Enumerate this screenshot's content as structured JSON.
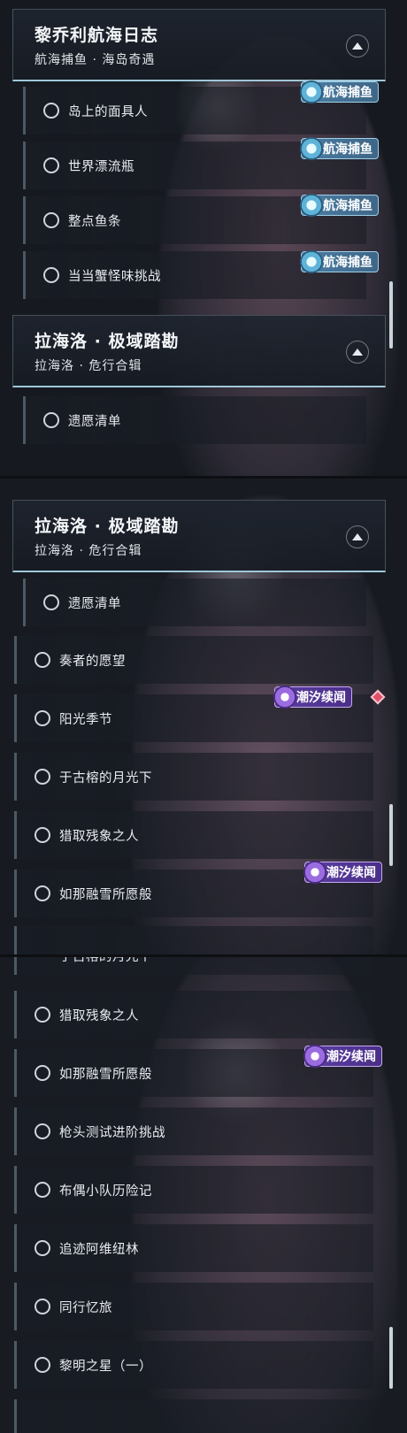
{
  "sections": [
    {
      "title": "黎乔利航海日志",
      "subtitle": "航海捕鱼 · 海岛奇遇"
    },
    {
      "title": "拉海洛 · 极域踏勘",
      "subtitle": "拉海洛 · 危行合辑"
    }
  ],
  "badges": {
    "fishing": "航海捕鱼",
    "tide": "潮汐续闻"
  },
  "icons": {
    "collapse": "chevron-up-icon",
    "fishing_badge": "fishing-badge-icon",
    "tide_badge": "tide-badge-icon",
    "alert": "red-diamond-icon"
  },
  "colors": {
    "accent_line": "#9fc7d8",
    "fishing_badge": "#3e6687",
    "tide_badge": "#4a2f88",
    "alert": "#e0506a"
  },
  "seg1": {
    "header_title": "黎乔利航海日志",
    "header_sub": "航海捕鱼 · 海岛奇遇",
    "items": [
      "岛上的面具人",
      "世界漂流瓶",
      "整点鱼条",
      "当当蟹怪味挑战"
    ],
    "header2_title": "拉海洛 · 极域踏勘",
    "header2_sub": "拉海洛 · 危行合辑",
    "item_after": "遗愿清单"
  },
  "seg2": {
    "header_title": "拉海洛 · 极域踏勘",
    "header_sub": "拉海洛 · 危行合辑",
    "items": [
      "遗愿清单",
      "奏者的愿望",
      "阳光季节",
      "于古榕的月光下",
      "猎取残象之人",
      "如那融雪所愿般"
    ]
  },
  "seg3": {
    "partial_item": "于古榕的月光下",
    "items": [
      "猎取残象之人",
      "如那融雪所愿般",
      "枪头测试进阶挑战",
      "布偶小队历险记",
      "追迹阿维纽林",
      "同行忆旅",
      "黎明之星（一）"
    ]
  }
}
